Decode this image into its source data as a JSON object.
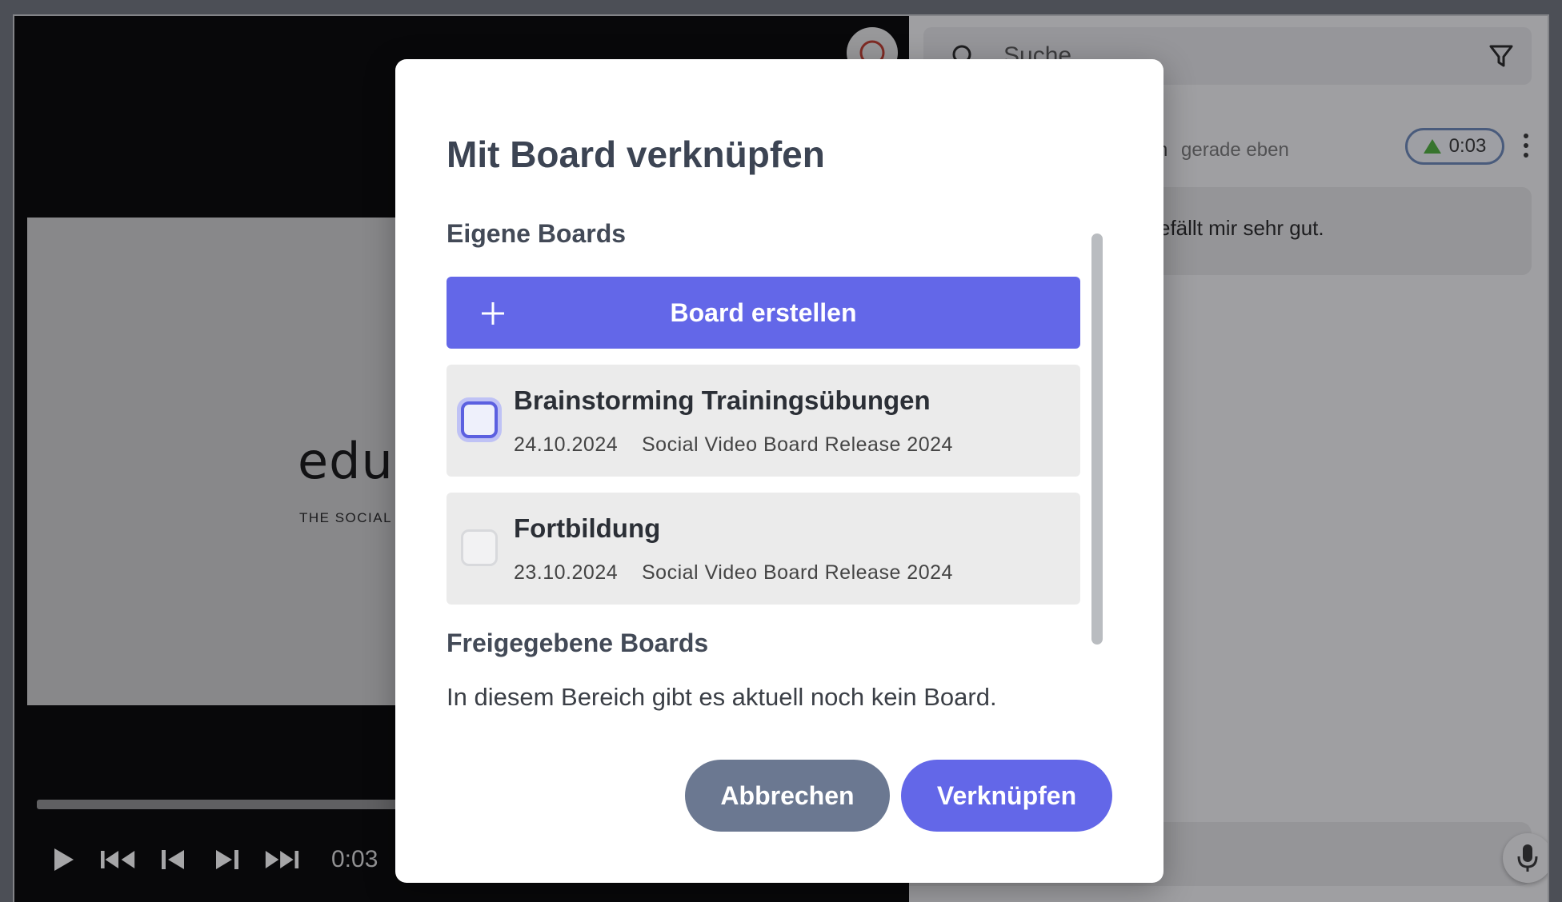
{
  "video": {
    "slide_logo": "edu",
    "slide_tagline": "THE SOCIAL VI",
    "current_time": "0:03"
  },
  "side_panel": {
    "search_placeholder": "Suche",
    "comment": {
      "author": "n",
      "time": "gerade eben",
      "timestamp_badge": "0:03",
      "text": "efällt mir sehr gut."
    }
  },
  "modal": {
    "title": "Mit Board verknüpfen",
    "own_boards_title": "Eigene Boards",
    "create_board_label": "Board erstellen",
    "boards": [
      {
        "name": "Brainstorming Trainingsübungen",
        "date": "24.10.2024",
        "project": "Social Video Board Release 2024",
        "focused": true
      },
      {
        "name": "Fortbildung",
        "date": "23.10.2024",
        "project": "Social Video Board Release 2024",
        "focused": false
      }
    ],
    "shared_boards_title": "Freigegebene Boards",
    "empty_text": "In diesem Bereich gibt es aktuell noch kein Board.",
    "cancel_label": "Abbrechen",
    "link_label": "Verknüpfen"
  },
  "colors": {
    "primary": "#6367e8",
    "secondary": "#6b7891",
    "badge_triangle": "#4caf3b"
  }
}
